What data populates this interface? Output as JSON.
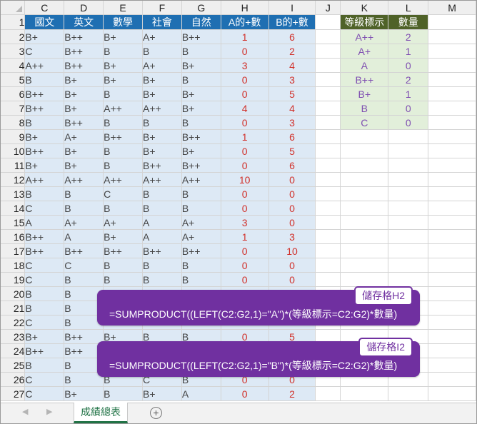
{
  "columns": [
    "C",
    "D",
    "E",
    "F",
    "G",
    "H",
    "I",
    "J",
    "K",
    "L",
    "M"
  ],
  "header": [
    "國文",
    "英文",
    "數學",
    "社會",
    "自然",
    "A的+數",
    "B的+數"
  ],
  "rows": [
    {
      "num": "1",
      "vals": []
    },
    {
      "num": "2",
      "vals": [
        "B+",
        "B++",
        "B+",
        "A+",
        "B++",
        "1",
        "6"
      ]
    },
    {
      "num": "3",
      "vals": [
        "C",
        "B++",
        "B",
        "B",
        "B",
        "0",
        "2"
      ]
    },
    {
      "num": "4",
      "vals": [
        "A++",
        "B++",
        "B+",
        "A+",
        "B+",
        "3",
        "4"
      ]
    },
    {
      "num": "5",
      "vals": [
        "B",
        "B+",
        "B+",
        "B+",
        "B",
        "0",
        "3"
      ]
    },
    {
      "num": "6",
      "vals": [
        "B++",
        "B+",
        "B",
        "B+",
        "B+",
        "0",
        "5"
      ]
    },
    {
      "num": "7",
      "vals": [
        "B++",
        "B+",
        "A++",
        "A++",
        "B+",
        "4",
        "4"
      ]
    },
    {
      "num": "8",
      "vals": [
        "B",
        "B++",
        "B",
        "B",
        "B",
        "0",
        "3"
      ]
    },
    {
      "num": "9",
      "vals": [
        "B+",
        "A+",
        "B++",
        "B+",
        "B++",
        "1",
        "6"
      ]
    },
    {
      "num": "10",
      "vals": [
        "B++",
        "B+",
        "B",
        "B+",
        "B+",
        "0",
        "5"
      ]
    },
    {
      "num": "11",
      "vals": [
        "B+",
        "B+",
        "B",
        "B++",
        "B++",
        "0",
        "6"
      ]
    },
    {
      "num": "12",
      "vals": [
        "A++",
        "A++",
        "A++",
        "A++",
        "A++",
        "10",
        "0"
      ]
    },
    {
      "num": "13",
      "vals": [
        "B",
        "B",
        "C",
        "B",
        "B",
        "0",
        "0"
      ]
    },
    {
      "num": "14",
      "vals": [
        "C",
        "B",
        "B",
        "B",
        "B",
        "0",
        "0"
      ]
    },
    {
      "num": "15",
      "vals": [
        "A",
        "A+",
        "A+",
        "A",
        "A+",
        "3",
        "0"
      ]
    },
    {
      "num": "16",
      "vals": [
        "B++",
        "A",
        "B+",
        "A",
        "A+",
        "1",
        "3"
      ]
    },
    {
      "num": "17",
      "vals": [
        "B++",
        "B++",
        "B++",
        "B++",
        "B++",
        "0",
        "10"
      ]
    },
    {
      "num": "18",
      "vals": [
        "C",
        "C",
        "B",
        "B",
        "B",
        "0",
        "0"
      ]
    },
    {
      "num": "19",
      "vals": [
        "C",
        "B",
        "B",
        "B",
        "B",
        "0",
        "0"
      ]
    },
    {
      "num": "20",
      "vals": [
        "B",
        "B",
        "",
        "",
        "",
        "",
        ""
      ]
    },
    {
      "num": "21",
      "vals": [
        "B",
        "B",
        "",
        "",
        "",
        "",
        ""
      ]
    },
    {
      "num": "22",
      "vals": [
        "C",
        "B",
        "",
        "",
        "",
        "",
        ""
      ]
    },
    {
      "num": "23",
      "vals": [
        "B+",
        "B++",
        "B+",
        "B",
        "B",
        "0",
        "5"
      ]
    },
    {
      "num": "24",
      "vals": [
        "B++",
        "B++",
        "",
        "",
        "",
        "",
        ""
      ]
    },
    {
      "num": "25",
      "vals": [
        "B",
        "B",
        "",
        "",
        "",
        "",
        ""
      ]
    },
    {
      "num": "26",
      "vals": [
        "C",
        "B",
        "B",
        "C",
        "B",
        "0",
        "0"
      ]
    },
    {
      "num": "27",
      "vals": [
        "C",
        "B+",
        "B",
        "B+",
        "A",
        "0",
        "2"
      ]
    }
  ],
  "lookup": {
    "header": [
      "等級標示",
      "數量"
    ],
    "items": [
      {
        "grade": "A++",
        "count": "2"
      },
      {
        "grade": "A+",
        "count": "1"
      },
      {
        "grade": "A",
        "count": "0"
      },
      {
        "grade": "B++",
        "count": "2"
      },
      {
        "grade": "B+",
        "count": "1"
      },
      {
        "grade": "B",
        "count": "0"
      },
      {
        "grade": "C",
        "count": "0"
      }
    ]
  },
  "callouts": [
    {
      "label": "儲存格H2",
      "formula": "=SUMPRODUCT((LEFT(C2:G2,1)=\"A\")*(等級標示=C2:G2)*數量)"
    },
    {
      "label": "儲存格I2",
      "formula": "=SUMPRODUCT((LEFT(C2:G2,1)=\"B\")*(等級標示=C2:G2)*數量)"
    }
  ],
  "sheet_tab": "成績總表",
  "colors": {
    "header_blue": "#1f6fb2",
    "data_fill": "#dde9f5",
    "value_red": "#d1312a",
    "lookup_header": "#4f6228",
    "lookup_fill": "#e2efda",
    "lookup_text": "#7f4fb1",
    "callout": "#7030a0"
  }
}
